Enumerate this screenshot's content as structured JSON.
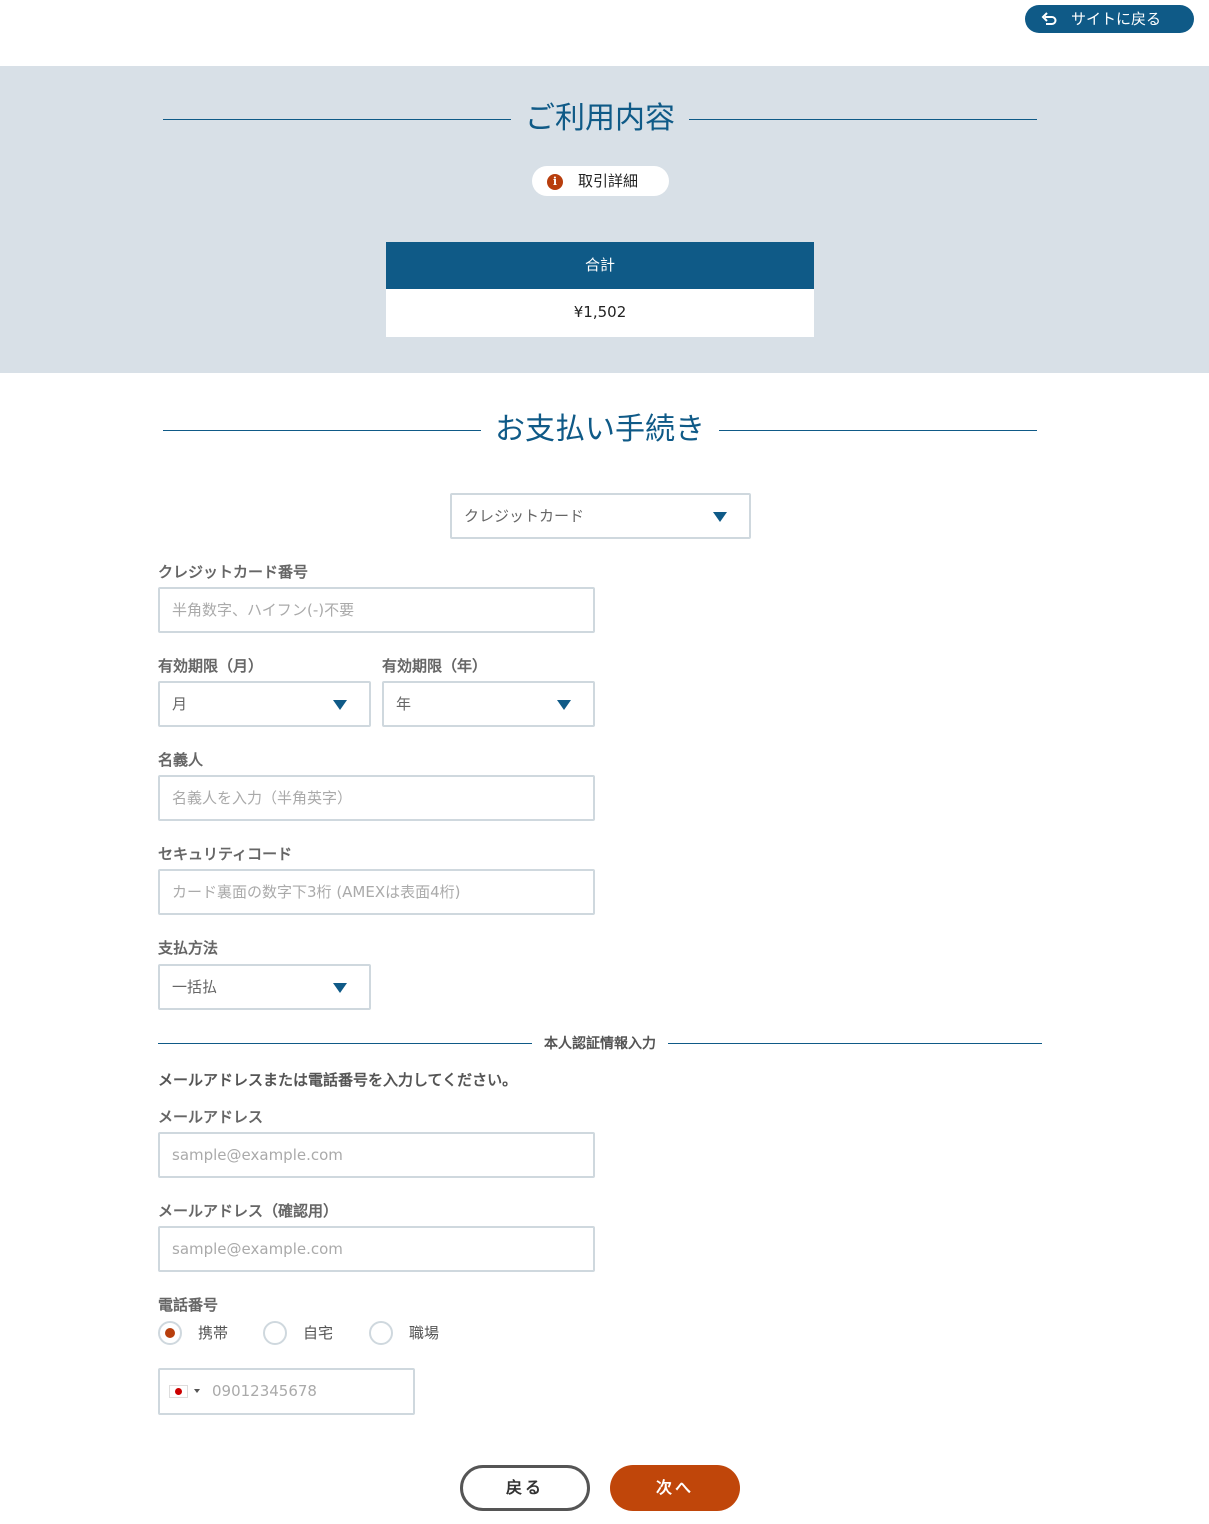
{
  "header": {
    "back_to_site_label": "サイトに戻る"
  },
  "usage": {
    "title": "ご利用内容",
    "details_label": "取引詳細",
    "total_header": "合計",
    "total_value": "¥1,502"
  },
  "payment": {
    "title": "お支払い手続き",
    "method_selected": "クレジットカード",
    "card_number_label": "クレジットカード番号",
    "card_number_placeholder": "半角数字、ハイフン(-)不要",
    "exp_month_label": "有効期限（月）",
    "exp_month_selected": "月",
    "exp_year_label": "有効期限（年）",
    "exp_year_selected": "年",
    "holder_label": "名義人",
    "holder_placeholder": "名義人を入力（半角英字）",
    "security_label": "セキュリティコード",
    "security_placeholder": "カード裏面の数字下3桁 (AMEXは表面4桁)",
    "pay_plan_label": "支払方法",
    "pay_plan_selected": "一括払"
  },
  "auth": {
    "section_label": "本人認証情報入力",
    "instruction": "メールアドレスまたは電話番号を入力してください。",
    "email_label": "メールアドレス",
    "email_placeholder": "sample@example.com",
    "email_confirm_label": "メールアドレス（確認用）",
    "email_confirm_placeholder": "sample@example.com",
    "phone_label": "電話番号",
    "phone_types": [
      {
        "label": "携帯",
        "selected": true
      },
      {
        "label": "自宅",
        "selected": false
      },
      {
        "label": "職場",
        "selected": false
      }
    ],
    "phone_placeholder": "09012345678",
    "phone_country_icon": "japan-flag-icon"
  },
  "actions": {
    "back_label": "戻る",
    "next_label": "次へ"
  },
  "colors": {
    "primary": "#0f5a87",
    "accent": "#c0460a",
    "band": "#d8e0e7"
  }
}
